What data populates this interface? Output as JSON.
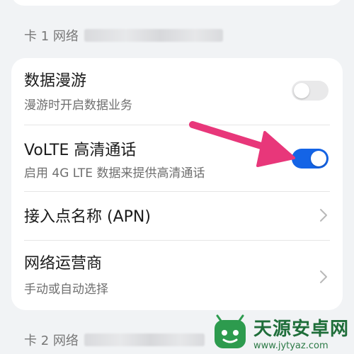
{
  "sections": {
    "card1_header": "卡 1 网络",
    "card2_header": "卡 2 网络"
  },
  "settings": [
    {
      "title": "数据漫游",
      "subtitle": "漫游时开启数据业务",
      "control": "toggle",
      "on": false
    },
    {
      "title": "VoLTE 高清通话",
      "subtitle": "启用 4G LTE 数据来提供高清通话",
      "control": "toggle",
      "on": true
    },
    {
      "title": "接入点名称 (APN)",
      "control": "chevron"
    },
    {
      "title": "网络运营商",
      "subtitle": "手动或自动选择",
      "control": "chevron"
    }
  ],
  "colors": {
    "accent": "#1464e6",
    "arrow": "#e8377a",
    "background": "#f1f3f5",
    "card": "#ffffff"
  },
  "icons": {
    "chevron": "chevron-right-icon",
    "annotation": "pointer-arrow-annotation"
  },
  "watermark": {
    "name": "天源安卓网",
    "url": "www.jytyaz.com"
  }
}
